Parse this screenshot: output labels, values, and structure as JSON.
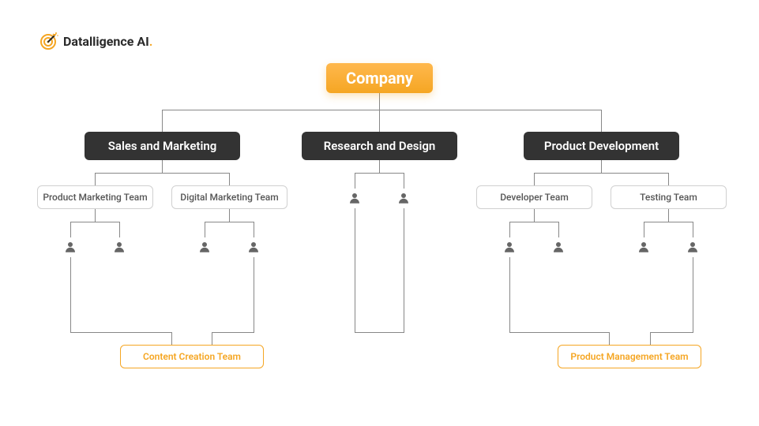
{
  "logo": {
    "brand": "Datalligence AI"
  },
  "nodes": {
    "company": "Company",
    "dept_sales": "Sales and Marketing",
    "dept_research": "Research  and Design",
    "dept_product": "Product Development",
    "team_pm": "Product Marketing Team",
    "team_dm": "Digital Marketing Team",
    "team_dev": "Developer Team",
    "team_test": "Testing Team",
    "bottom_content": "Content Creation Team",
    "bottom_prodmgmt": "Product Management Team"
  }
}
